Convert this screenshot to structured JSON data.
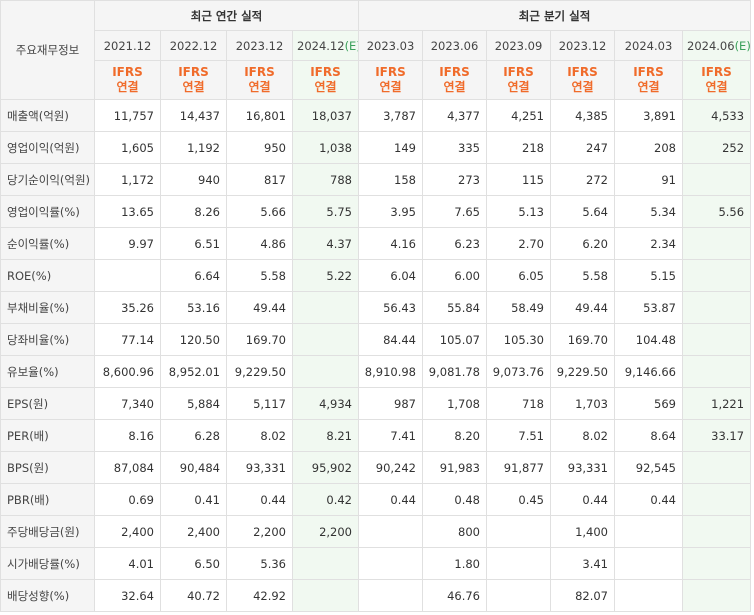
{
  "header": {
    "row_label_title": "주요재무정보",
    "annual_title": "최근 연간 실적",
    "quarterly_title": "최근 분기 실적",
    "annual_periods": [
      {
        "date": "2021.12",
        "note": ""
      },
      {
        "date": "2022.12",
        "note": ""
      },
      {
        "date": "2023.12",
        "note": ""
      },
      {
        "date": "2024.12",
        "note": "(E)"
      }
    ],
    "quarterly_periods": [
      {
        "date": "2023.03",
        "note": ""
      },
      {
        "date": "2023.06",
        "note": ""
      },
      {
        "date": "2023.09",
        "note": ""
      },
      {
        "date": "2023.12",
        "note": ""
      },
      {
        "date": "2024.03",
        "note": ""
      },
      {
        "date": "2024.06",
        "note": "(E)"
      }
    ],
    "ifrs_line1": "IFRS",
    "ifrs_line2": "연결"
  },
  "rows": [
    {
      "label": "매출액(억원)",
      "values": [
        "11,757",
        "14,437",
        "16,801",
        "18,037",
        "3,787",
        "4,377",
        "4,251",
        "4,385",
        "3,891",
        "4,533"
      ]
    },
    {
      "label": "영업이익(억원)",
      "values": [
        "1,605",
        "1,192",
        "950",
        "1,038",
        "149",
        "335",
        "218",
        "247",
        "208",
        "252"
      ]
    },
    {
      "label": "당기순이익(억원)",
      "values": [
        "1,172",
        "940",
        "817",
        "788",
        "158",
        "273",
        "115",
        "272",
        "91",
        ""
      ]
    },
    {
      "label": "영업이익률(%)",
      "values": [
        "13.65",
        "8.26",
        "5.66",
        "5.75",
        "3.95",
        "7.65",
        "5.13",
        "5.64",
        "5.34",
        "5.56"
      ]
    },
    {
      "label": "순이익률(%)",
      "values": [
        "9.97",
        "6.51",
        "4.86",
        "4.37",
        "4.16",
        "6.23",
        "2.70",
        "6.20",
        "2.34",
        ""
      ]
    },
    {
      "label": "ROE(%)",
      "values": [
        "",
        "6.64",
        "5.58",
        "5.22",
        "6.04",
        "6.00",
        "6.05",
        "5.58",
        "5.15",
        ""
      ]
    },
    {
      "label": "부채비율(%)",
      "values": [
        "35.26",
        "53.16",
        "49.44",
        "",
        "56.43",
        "55.84",
        "58.49",
        "49.44",
        "53.87",
        ""
      ]
    },
    {
      "label": "당좌비율(%)",
      "values": [
        "77.14",
        "120.50",
        "169.70",
        "",
        "84.44",
        "105.07",
        "105.30",
        "169.70",
        "104.48",
        ""
      ]
    },
    {
      "label": "유보율(%)",
      "values": [
        "8,600.96",
        "8,952.01",
        "9,229.50",
        "",
        "8,910.98",
        "9,081.78",
        "9,073.76",
        "9,229.50",
        "9,146.66",
        ""
      ]
    },
    {
      "label": "EPS(원)",
      "values": [
        "7,340",
        "5,884",
        "5,117",
        "4,934",
        "987",
        "1,708",
        "718",
        "1,703",
        "569",
        "1,221"
      ]
    },
    {
      "label": "PER(배)",
      "values": [
        "8.16",
        "6.28",
        "8.02",
        "8.21",
        "7.41",
        "8.20",
        "7.51",
        "8.02",
        "8.64",
        "33.17"
      ]
    },
    {
      "label": "BPS(원)",
      "values": [
        "87,084",
        "90,484",
        "93,331",
        "95,902",
        "90,242",
        "91,983",
        "91,877",
        "93,331",
        "92,545",
        ""
      ]
    },
    {
      "label": "PBR(배)",
      "values": [
        "0.69",
        "0.41",
        "0.44",
        "0.42",
        "0.44",
        "0.48",
        "0.45",
        "0.44",
        "0.44",
        ""
      ]
    },
    {
      "label": "주당배당금(원)",
      "values": [
        "2,400",
        "2,400",
        "2,200",
        "2,200",
        "",
        "800",
        "",
        "1,400",
        "",
        ""
      ]
    },
    {
      "label": "시가배당률(%)",
      "values": [
        "4.01",
        "6.50",
        "5.36",
        "",
        "",
        "1.80",
        "",
        "3.41",
        "",
        ""
      ]
    },
    {
      "label": "배당성향(%)",
      "values": [
        "32.64",
        "40.72",
        "42.92",
        "",
        "",
        "46.76",
        "",
        "82.07",
        "",
        ""
      ]
    }
  ]
}
